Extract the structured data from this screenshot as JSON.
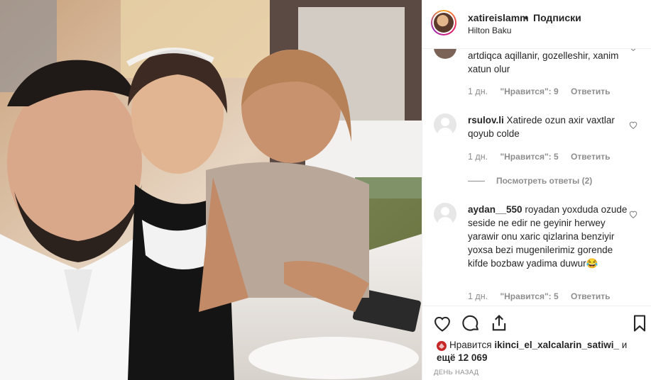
{
  "post": {
    "username": "xatireislamm",
    "separator": "•",
    "follow_label": "Подписки",
    "location": "Hilton Baku"
  },
  "comments": [
    {
      "username": "",
      "text": "artdiqca aqillanir, gozelleshir, xanim xatun olur",
      "time": "1 дн.",
      "likes": "\"Нравится\": 9",
      "reply": "Ответить"
    },
    {
      "username": "rsulov.li",
      "text": "Xatirede ozun axir vaxtlar qoyub colde",
      "time": "1 дн.",
      "likes": "\"Нравится\": 5",
      "reply": "Ответить",
      "view_replies": "Посмотреть ответы (2)"
    },
    {
      "username": "aydan__550",
      "text": "royadan yoxduda ozude seside ne edir ne geyinir herwey yarawir onu xaric qizlarina benziyir yoxsa bezi mugenilerimiz gorende kifde bozbaw yadima duwur😂",
      "time": "1 дн.",
      "likes": "\"Нравится\": 5",
      "reply": "Ответить"
    }
  ],
  "likes_summary": {
    "prefix": "Нравится",
    "liker": "ikinci_el_xalcalarin_satiwi_",
    "suffix": "и",
    "more": "ещё 12 069"
  },
  "date_label": "ДЕНЬ НАЗАД",
  "icons": [
    "heart-icon",
    "comment-icon",
    "share-icon",
    "bookmark-icon"
  ]
}
